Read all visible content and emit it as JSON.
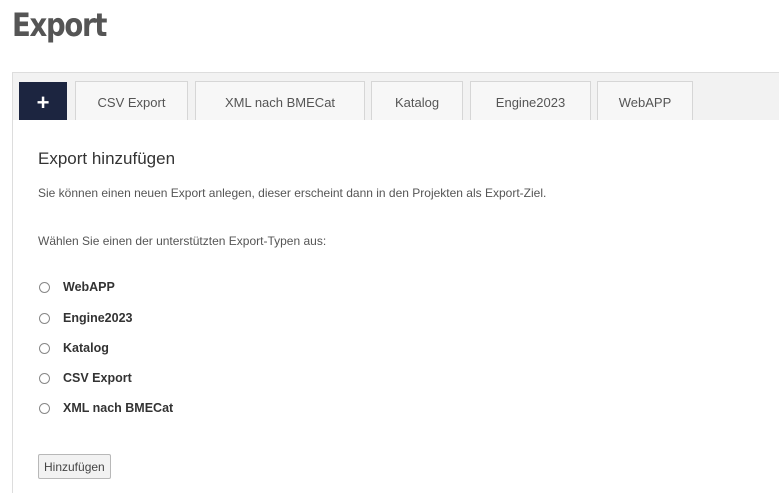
{
  "page": {
    "title": "Export"
  },
  "tabs": [
    {
      "label": "+",
      "active": true
    },
    {
      "label": "CSV Export"
    },
    {
      "label": "XML nach BMECat"
    },
    {
      "label": "Katalog"
    },
    {
      "label": "Engine2023"
    },
    {
      "label": "WebAPP"
    }
  ],
  "form": {
    "heading": "Export hinzufügen",
    "description": "Sie können einen neuen Export anlegen, dieser erscheint dann in den Projekten als Export-Ziel.",
    "prompt": "Wählen Sie einen der unterstützten Export-Typen aus:",
    "options": [
      {
        "label": "WebAPP",
        "selected": false
      },
      {
        "label": "Engine2023",
        "selected": false
      },
      {
        "label": "Katalog",
        "selected": false
      },
      {
        "label": "CSV Export",
        "selected": false
      },
      {
        "label": "XML nach BMECat",
        "selected": false
      }
    ],
    "submit_label": "Hinzufügen"
  },
  "colors": {
    "active_tab": "#1c2540",
    "tab_background": "#f7f7f7",
    "tab_bar": "#f2f2f2"
  }
}
